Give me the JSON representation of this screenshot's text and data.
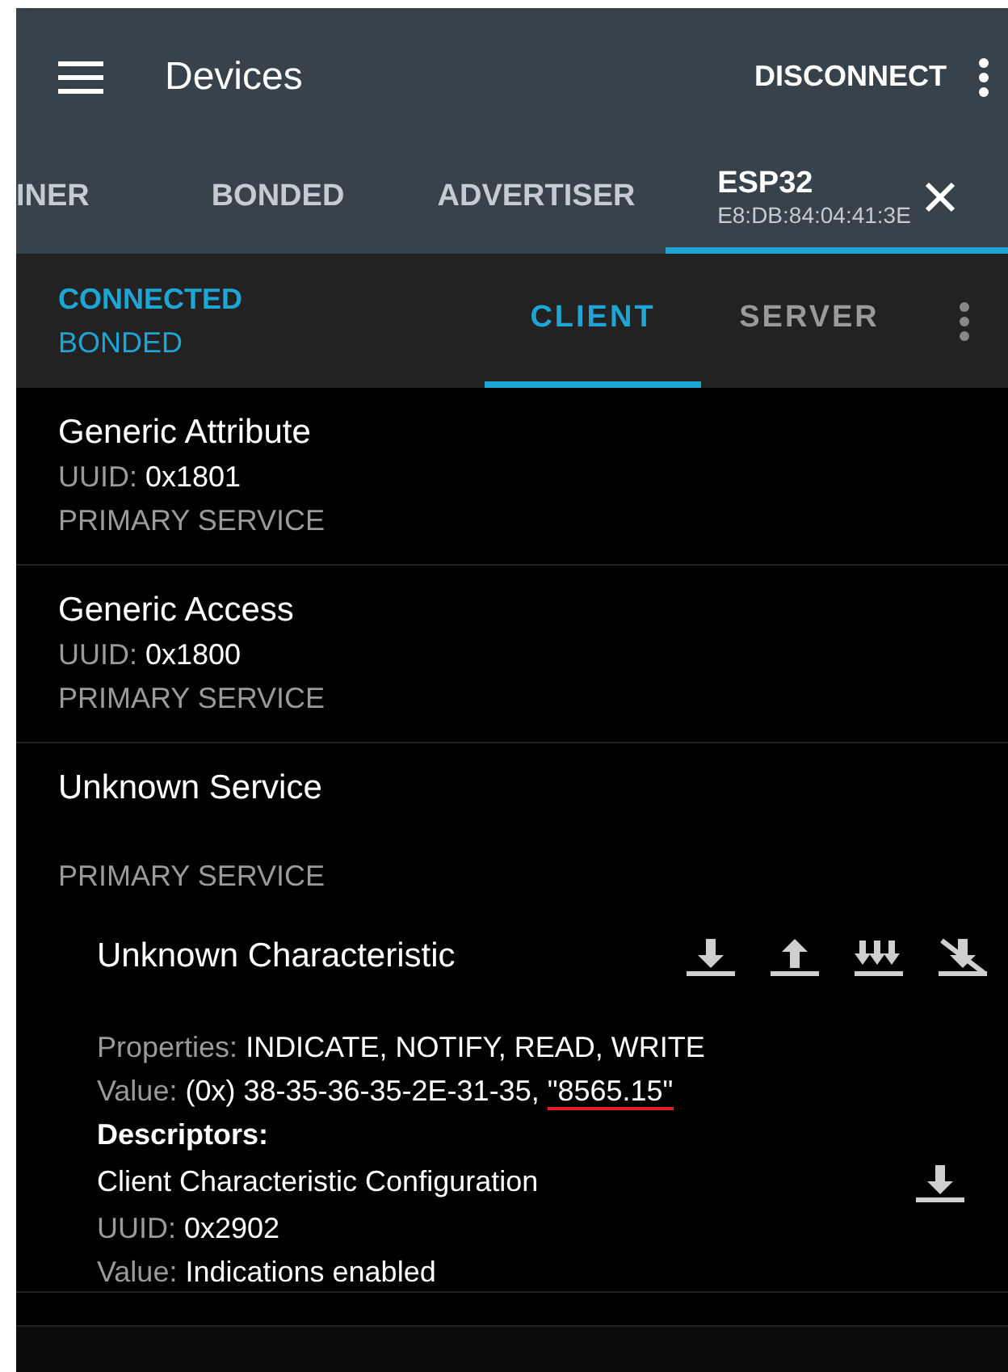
{
  "app_bar": {
    "title": "Devices",
    "action": "DISCONNECT"
  },
  "tabs": [
    {
      "label": "INER",
      "selected": false
    },
    {
      "label": "BONDED",
      "selected": false
    },
    {
      "label": "ADVERTISER",
      "selected": false
    },
    {
      "label": "ESP32",
      "subtitle": "E8:DB:84:04:41:3E",
      "selected": true,
      "closable": true
    }
  ],
  "status": [
    "CONNECTED",
    "BONDED"
  ],
  "sub_tabs": [
    {
      "label": "CLIENT",
      "selected": true
    },
    {
      "label": "SERVER",
      "selected": false
    }
  ],
  "services": [
    {
      "name": "Generic Attribute",
      "uuid_label": "UUID:",
      "uuid": "0x1801",
      "type": "PRIMARY SERVICE"
    },
    {
      "name": "Generic Access",
      "uuid_label": "UUID:",
      "uuid": "0x1800",
      "type": "PRIMARY SERVICE"
    },
    {
      "name": "Unknown Service",
      "type": "PRIMARY SERVICE",
      "characteristic": {
        "name": "Unknown Characteristic",
        "properties_label": "Properties:",
        "properties": "INDICATE, NOTIFY, READ, WRITE",
        "value_label": "Value:",
        "value": "(0x) 38-35-36-35-2E-31-35, ",
        "value_marked": "\"8565.15\"",
        "descriptors_heading": "Descriptors:",
        "descriptor": {
          "name": "Client Characteristic Configuration",
          "uuid_label": "UUID:",
          "uuid": "0x2902",
          "value_label": "Value:",
          "value": "Indications enabled"
        }
      }
    }
  ]
}
